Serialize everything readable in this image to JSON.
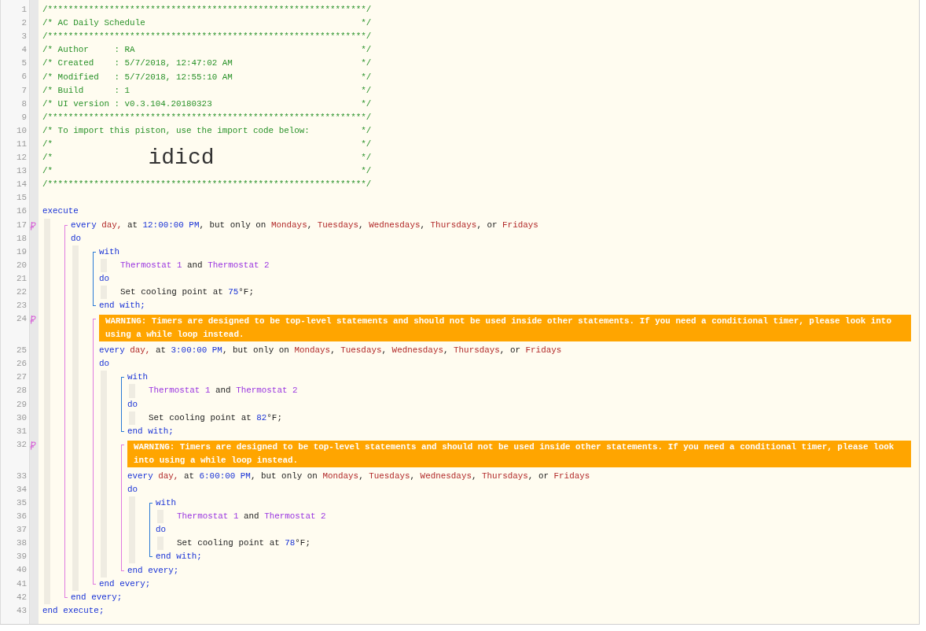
{
  "lines": [
    {
      "kind": "comment",
      "number": "1",
      "text": "/**************************************************************/"
    },
    {
      "kind": "comment",
      "number": "2",
      "text": "/* AC Daily Schedule",
      "end": "*/"
    },
    {
      "kind": "comment",
      "number": "3",
      "text": "/**************************************************************/"
    },
    {
      "kind": "comment",
      "number": "4",
      "text": "/* Author     : RA",
      "end": "*/"
    },
    {
      "kind": "comment",
      "number": "5",
      "text": "/* Created    : 5/7/2018, 12:47:02 AM",
      "end": "*/"
    },
    {
      "kind": "comment",
      "number": "6",
      "text": "/* Modified   : 5/7/2018, 12:55:10 AM",
      "end": "*/"
    },
    {
      "kind": "comment",
      "number": "7",
      "text": "/* Build      : 1",
      "end": "*/"
    },
    {
      "kind": "comment",
      "number": "8",
      "text": "/* UI version : v0.3.104.20180323",
      "end": "*/"
    },
    {
      "kind": "comment",
      "number": "9",
      "text": "/**************************************************************/"
    },
    {
      "kind": "comment",
      "number": "10",
      "text": "/* To import this piston, use the import code below:",
      "end": "*/"
    },
    {
      "kind": "comment",
      "number": "11",
      "text": "/*",
      "end": "*/"
    },
    {
      "kind": "import",
      "number": "12",
      "text": "/*",
      "code": "idicd",
      "end": "*/"
    },
    {
      "kind": "comment",
      "number": "13",
      "text": "/*",
      "end": "*/"
    },
    {
      "kind": "comment",
      "number": "14",
      "text": "/**************************************************************/"
    },
    {
      "kind": "blank",
      "number": "15"
    },
    {
      "kind": "code",
      "number": "16",
      "flagged": false,
      "tokens": [
        {
          "text": "execute",
          "kind": "keyword"
        }
      ]
    },
    {
      "kind": "body",
      "children": [
        {
          "kind": "every_block",
          "items": [
            {
              "kind": "code",
              "number": "17",
              "flagged": true,
              "tokens": [
                {
                  "text": "every",
                  "kind": "keyword"
                },
                {
                  "text": " day,",
                  "kind": "value"
                },
                {
                  "text": " at ",
                  "kind": "plain"
                },
                {
                  "text": "12:00:00 PM",
                  "kind": "time"
                },
                {
                  "text": ", but only on ",
                  "kind": "plain"
                },
                {
                  "text": "Mondays",
                  "kind": "value"
                },
                {
                  "text": ", ",
                  "kind": "plain"
                },
                {
                  "text": "Tuesdays",
                  "kind": "value"
                },
                {
                  "text": ", ",
                  "kind": "plain"
                },
                {
                  "text": "Wednesdays",
                  "kind": "value"
                },
                {
                  "text": ", ",
                  "kind": "plain"
                },
                {
                  "text": "Thursdays",
                  "kind": "value"
                },
                {
                  "text": ", or ",
                  "kind": "plain"
                },
                {
                  "text": "Fridays",
                  "kind": "value"
                }
              ]
            },
            {
              "kind": "code",
              "number": "18",
              "flagged": false,
              "tokens": [
                {
                  "text": "do",
                  "kind": "keyword"
                }
              ]
            },
            {
              "kind": "body",
              "children": [
                {
                  "kind": "with_block",
                  "items": [
                    {
                      "kind": "code",
                      "number": "19",
                      "flagged": false,
                      "tokens": [
                        {
                          "text": "with",
                          "kind": "keyword"
                        }
                      ]
                    },
                    {
                      "kind": "body",
                      "children": [
                        {
                          "kind": "code",
                          "number": "20",
                          "flagged": false,
                          "tokens": [
                            {
                              "text": "Thermostat 1",
                              "kind": "device"
                            },
                            {
                              "text": " and ",
                              "kind": "plain"
                            },
                            {
                              "text": "Thermostat 2",
                              "kind": "device"
                            }
                          ]
                        }
                      ]
                    },
                    {
                      "kind": "code",
                      "number": "21",
                      "flagged": false,
                      "tokens": [
                        {
                          "text": "do",
                          "kind": "keyword"
                        }
                      ]
                    },
                    {
                      "kind": "body",
                      "children": [
                        {
                          "kind": "code",
                          "number": "22",
                          "flagged": false,
                          "tokens": [
                            {
                              "text": "Set cooling point at ",
                              "kind": "plain"
                            },
                            {
                              "text": "75",
                              "kind": "number"
                            },
                            {
                              "text": "°F;",
                              "kind": "plain"
                            }
                          ]
                        }
                      ]
                    },
                    {
                      "kind": "code",
                      "number": "23",
                      "flagged": false,
                      "tokens": [
                        {
                          "text": "end with;",
                          "kind": "keyword"
                        }
                      ]
                    }
                  ]
                },
                {
                  "kind": "every_block",
                  "items": [
                    {
                      "kind": "warning",
                      "number": "24",
                      "flagged": true,
                      "text": "WARNING: Timers are designed to be top-level statements and should not be used inside other statements. If you need a conditional timer, please look into using a while loop instead."
                    },
                    {
                      "kind": "code",
                      "number": "25",
                      "flagged": false,
                      "tokens": [
                        {
                          "text": "every",
                          "kind": "keyword"
                        },
                        {
                          "text": " day,",
                          "kind": "value"
                        },
                        {
                          "text": " at ",
                          "kind": "plain"
                        },
                        {
                          "text": "3:00:00 PM",
                          "kind": "time"
                        },
                        {
                          "text": ", but only on ",
                          "kind": "plain"
                        },
                        {
                          "text": "Mondays",
                          "kind": "value"
                        },
                        {
                          "text": ", ",
                          "kind": "plain"
                        },
                        {
                          "text": "Tuesdays",
                          "kind": "value"
                        },
                        {
                          "text": ", ",
                          "kind": "plain"
                        },
                        {
                          "text": "Wednesdays",
                          "kind": "value"
                        },
                        {
                          "text": ", ",
                          "kind": "plain"
                        },
                        {
                          "text": "Thursdays",
                          "kind": "value"
                        },
                        {
                          "text": ", or ",
                          "kind": "plain"
                        },
                        {
                          "text": "Fridays",
                          "kind": "value"
                        }
                      ]
                    },
                    {
                      "kind": "code",
                      "number": "26",
                      "flagged": false,
                      "tokens": [
                        {
                          "text": "do",
                          "kind": "keyword"
                        }
                      ]
                    },
                    {
                      "kind": "body",
                      "children": [
                        {
                          "kind": "with_block",
                          "items": [
                            {
                              "kind": "code",
                              "number": "27",
                              "flagged": false,
                              "tokens": [
                                {
                                  "text": "with",
                                  "kind": "keyword"
                                }
                              ]
                            },
                            {
                              "kind": "body",
                              "children": [
                                {
                                  "kind": "code",
                                  "number": "28",
                                  "flagged": false,
                                  "tokens": [
                                    {
                                      "text": "Thermostat 1",
                                      "kind": "device"
                                    },
                                    {
                                      "text": " and ",
                                      "kind": "plain"
                                    },
                                    {
                                      "text": "Thermostat 2",
                                      "kind": "device"
                                    }
                                  ]
                                }
                              ]
                            },
                            {
                              "kind": "code",
                              "number": "29",
                              "flagged": false,
                              "tokens": [
                                {
                                  "text": "do",
                                  "kind": "keyword"
                                }
                              ]
                            },
                            {
                              "kind": "body",
                              "children": [
                                {
                                  "kind": "code",
                                  "number": "30",
                                  "flagged": false,
                                  "tokens": [
                                    {
                                      "text": "Set cooling point at ",
                                      "kind": "plain"
                                    },
                                    {
                                      "text": "82",
                                      "kind": "number"
                                    },
                                    {
                                      "text": "°F;",
                                      "kind": "plain"
                                    }
                                  ]
                                }
                              ]
                            },
                            {
                              "kind": "code",
                              "number": "31",
                              "flagged": false,
                              "tokens": [
                                {
                                  "text": "end with;",
                                  "kind": "keyword"
                                }
                              ]
                            }
                          ]
                        },
                        {
                          "kind": "every_block",
                          "items": [
                            {
                              "kind": "warning",
                              "number": "32",
                              "flagged": true,
                              "text": "WARNING: Timers are designed to be top-level statements and should not be used inside other statements. If you need a conditional timer, please look into using a while loop instead."
                            },
                            {
                              "kind": "code",
                              "number": "33",
                              "flagged": false,
                              "tokens": [
                                {
                                  "text": "every",
                                  "kind": "keyword"
                                },
                                {
                                  "text": " day,",
                                  "kind": "value"
                                },
                                {
                                  "text": " at ",
                                  "kind": "plain"
                                },
                                {
                                  "text": "6:00:00 PM",
                                  "kind": "time"
                                },
                                {
                                  "text": ", but only on ",
                                  "kind": "plain"
                                },
                                {
                                  "text": "Mondays",
                                  "kind": "value"
                                },
                                {
                                  "text": ", ",
                                  "kind": "plain"
                                },
                                {
                                  "text": "Tuesdays",
                                  "kind": "value"
                                },
                                {
                                  "text": ", ",
                                  "kind": "plain"
                                },
                                {
                                  "text": "Wednesdays",
                                  "kind": "value"
                                },
                                {
                                  "text": ", ",
                                  "kind": "plain"
                                },
                                {
                                  "text": "Thursdays",
                                  "kind": "value"
                                },
                                {
                                  "text": ", or ",
                                  "kind": "plain"
                                },
                                {
                                  "text": "Fridays",
                                  "kind": "value"
                                }
                              ]
                            },
                            {
                              "kind": "code",
                              "number": "34",
                              "flagged": false,
                              "tokens": [
                                {
                                  "text": "do",
                                  "kind": "keyword"
                                }
                              ]
                            },
                            {
                              "kind": "body",
                              "children": [
                                {
                                  "kind": "with_block",
                                  "items": [
                                    {
                                      "kind": "code",
                                      "number": "35",
                                      "flagged": false,
                                      "tokens": [
                                        {
                                          "text": "with",
                                          "kind": "keyword"
                                        }
                                      ]
                                    },
                                    {
                                      "kind": "body",
                                      "children": [
                                        {
                                          "kind": "code",
                                          "number": "36",
                                          "flagged": false,
                                          "tokens": [
                                            {
                                              "text": "Thermostat 1",
                                              "kind": "device"
                                            },
                                            {
                                              "text": " and ",
                                              "kind": "plain"
                                            },
                                            {
                                              "text": "Thermostat 2",
                                              "kind": "device"
                                            }
                                          ]
                                        }
                                      ]
                                    },
                                    {
                                      "kind": "code",
                                      "number": "37",
                                      "flagged": false,
                                      "tokens": [
                                        {
                                          "text": "do",
                                          "kind": "keyword"
                                        }
                                      ]
                                    },
                                    {
                                      "kind": "body",
                                      "children": [
                                        {
                                          "kind": "code",
                                          "number": "38",
                                          "flagged": false,
                                          "tokens": [
                                            {
                                              "text": "Set cooling point at ",
                                              "kind": "plain"
                                            },
                                            {
                                              "text": "78",
                                              "kind": "number"
                                            },
                                            {
                                              "text": "°F;",
                                              "kind": "plain"
                                            }
                                          ]
                                        }
                                      ]
                                    },
                                    {
                                      "kind": "code",
                                      "number": "39",
                                      "flagged": false,
                                      "tokens": [
                                        {
                                          "text": "end with;",
                                          "kind": "keyword"
                                        }
                                      ]
                                    }
                                  ]
                                }
                              ]
                            },
                            {
                              "kind": "code",
                              "number": "40",
                              "flagged": false,
                              "tokens": [
                                {
                                  "text": "end every;",
                                  "kind": "keyword"
                                }
                              ]
                            }
                          ]
                        }
                      ]
                    },
                    {
                      "kind": "code",
                      "number": "41",
                      "flagged": false,
                      "tokens": [
                        {
                          "text": "end every;",
                          "kind": "keyword"
                        }
                      ]
                    }
                  ]
                }
              ]
            },
            {
              "kind": "code",
              "number": "42",
              "flagged": false,
              "tokens": [
                {
                  "text": "end every;",
                  "kind": "keyword"
                }
              ]
            }
          ]
        }
      ]
    },
    {
      "kind": "code",
      "number": "43",
      "flagged": false,
      "tokens": [
        {
          "text": "end execute;",
          "kind": "keyword"
        }
      ]
    }
  ]
}
